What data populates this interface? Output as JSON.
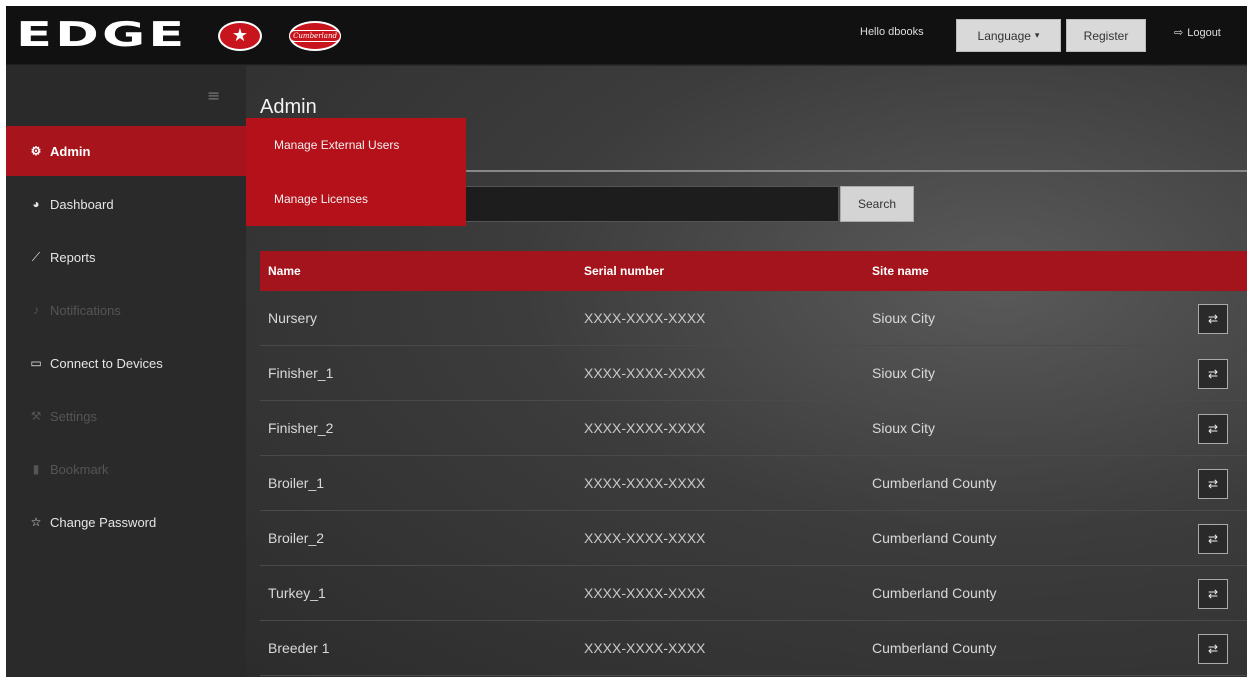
{
  "brand": {
    "logo_text": "EDGE",
    "badge_one": "★",
    "badge_two": "Cumberland"
  },
  "header": {
    "greeting": "Hello dbooks",
    "language_label": "Language",
    "register_label": "Register",
    "logout_label": "Logout"
  },
  "sidebar": {
    "items": [
      {
        "label": "Admin",
        "icon": "gear-icon",
        "active": true
      },
      {
        "label": "Dashboard",
        "icon": "dashboard-icon"
      },
      {
        "label": "Reports",
        "icon": "chart-icon"
      },
      {
        "label": "Notifications",
        "icon": "bell-icon",
        "dim": true
      },
      {
        "label": "Connect to Devices",
        "icon": "keyboard-icon"
      },
      {
        "label": "Settings",
        "icon": "wrench-icon",
        "dim": true
      },
      {
        "label": "Bookmark",
        "icon": "bookmark-icon",
        "dim": true
      },
      {
        "label": "Change Password",
        "icon": "star-icon"
      }
    ]
  },
  "main": {
    "title": "Admin",
    "dropdown": [
      "Manage External Users",
      "Manage Licenses"
    ],
    "search": {
      "placeholder": "",
      "button_label": "Search"
    },
    "table": {
      "columns": [
        "Name",
        "Serial number",
        "Site name"
      ],
      "rows": [
        [
          "Nursery",
          "XXXX-XXXX-XXXX",
          "Sioux City"
        ],
        [
          "Finisher_1",
          "XXXX-XXXX-XXXX",
          "Sioux City"
        ],
        [
          "Finisher_2",
          "XXXX-XXXX-XXXX",
          "Sioux City"
        ],
        [
          "Broiler_1",
          "XXXX-XXXX-XXXX",
          "Cumberland County"
        ],
        [
          "Broiler_2",
          "XXXX-XXXX-XXXX",
          "Cumberland County"
        ],
        [
          "Turkey_1",
          "XXXX-XXXX-XXXX",
          "Cumberland County"
        ],
        [
          "Breeder 1",
          "XXXX-XXXX-XXXX",
          "Cumberland County"
        ]
      ]
    }
  },
  "colors": {
    "accent": "#a8141c",
    "topbar": "#111111",
    "sidebar": "#2a2a2a"
  }
}
